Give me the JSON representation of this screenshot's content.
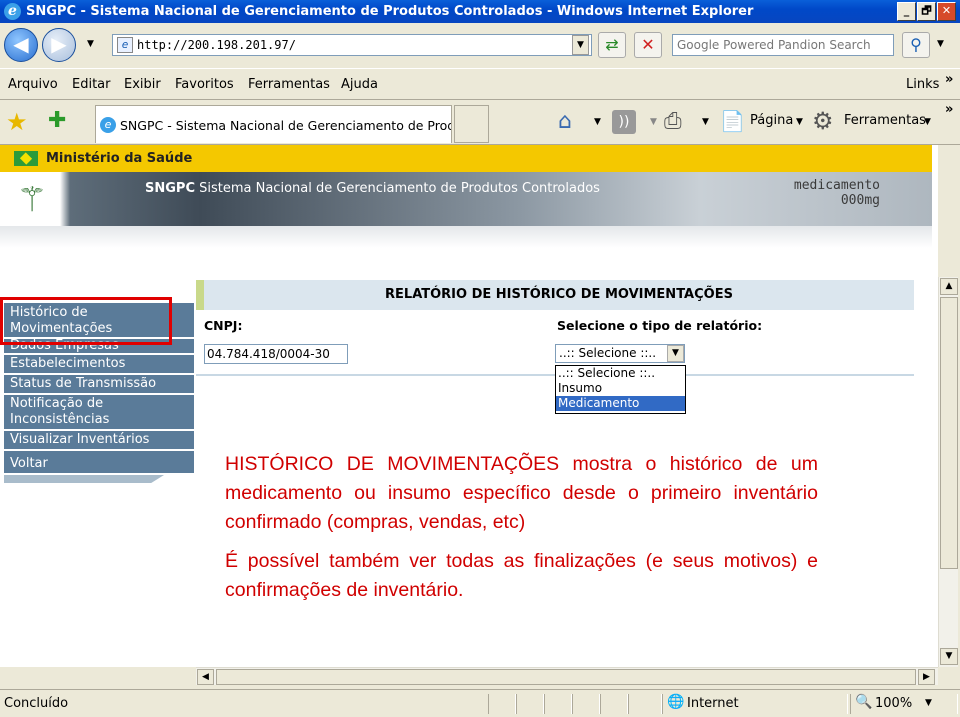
{
  "window": {
    "title": "SNGPC - Sistema Nacional de Gerenciamento de Produtos Controlados - Windows Internet Explorer",
    "controls": [
      "_",
      "🗗",
      "✕"
    ]
  },
  "address": {
    "url": "http://200.198.201.97/",
    "search_placeholder": "Google Powered Pandion Search"
  },
  "menubar": {
    "items": [
      "Arquivo",
      "Editar",
      "Exibir",
      "Favoritos",
      "Ferramentas",
      "Ajuda"
    ],
    "links_label": "Links"
  },
  "tabs": {
    "active_title": "SNGPC - Sistema Nacional de Gerenciamento de Produ..."
  },
  "toolbar": {
    "page_label": "Página",
    "tools_label": "Ferramentas"
  },
  "site": {
    "ministry": "Ministério da Saúde",
    "banner_brand": "SNGPC",
    "banner_text": "Sistema Nacional de Gerenciamento de Produtos Controlados",
    "banner_med_line1": "medicamento",
    "banner_med_line2": "000mg"
  },
  "sidebar": {
    "items": [
      "Histórico de Movimentações",
      "Dados Empresas",
      "Estabelecimentos",
      "Status de Transmissão",
      "Notificação de Inconsistências",
      "Visualizar Inventários",
      "Voltar"
    ]
  },
  "report": {
    "title": "RELATÓRIO DE HISTÓRICO DE MOVIMENTAÇÕES",
    "cnpj_label": "CNPJ:",
    "cnpj_value": "04.784.418/0004-30",
    "type_label": "Selecione o tipo de relatório:",
    "select_value": "..:: Selecione ::..",
    "options": [
      "..:: Selecione ::..",
      "Insumo",
      "Medicamento"
    ]
  },
  "note": {
    "para1": "HISTÓRICO DE MOVIMENTAÇÕES mostra o histórico de um medicamento ou insumo específico desde o primeiro inventário confirmado (compras, vendas, etc)",
    "para2": "É possível também ver todas as finalizações (e seus motivos) e confirmações de inventário."
  },
  "status": {
    "text": "Concluído",
    "zone": "Internet",
    "zoom": "100%"
  },
  "colors": {
    "note_red": "#d00000",
    "sidebar_blue": "#5a7b99",
    "ministry_yellow": "#f4c800",
    "highlight_red": "#e00000"
  }
}
